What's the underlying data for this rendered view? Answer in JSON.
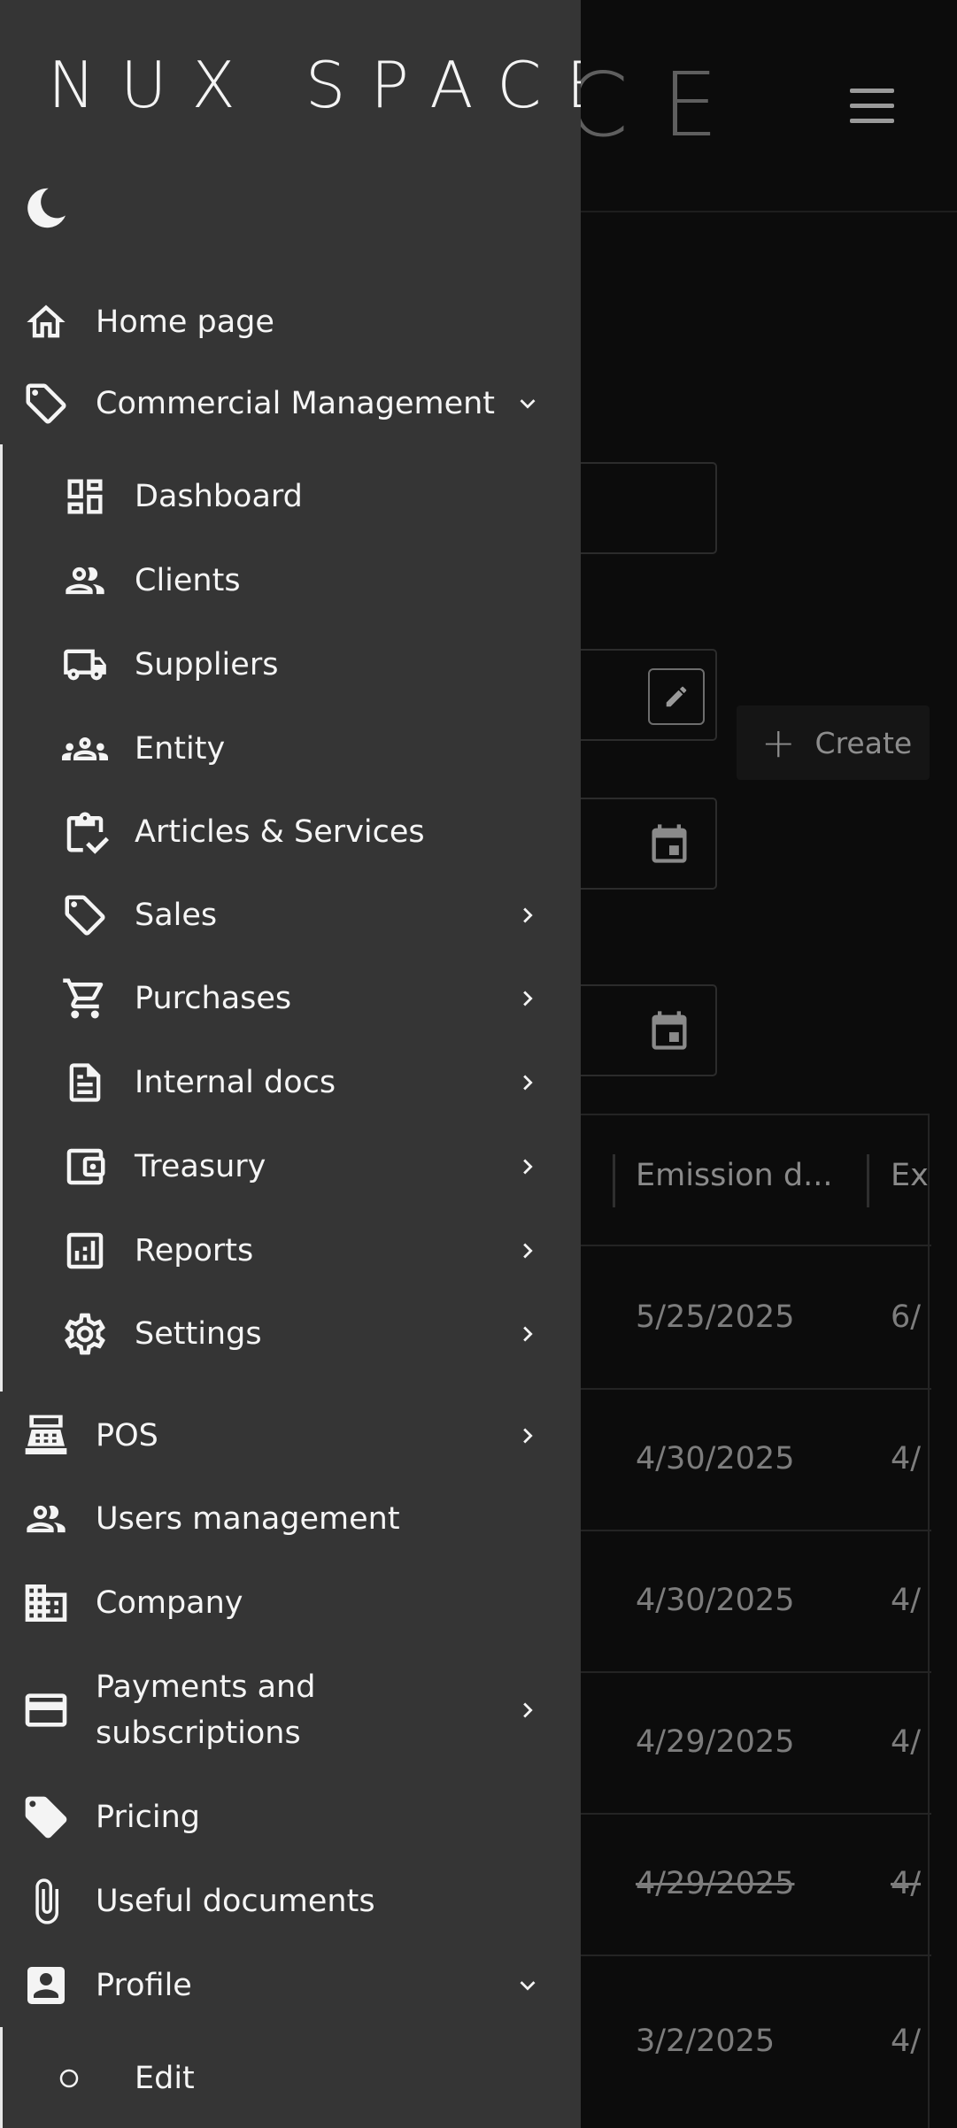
{
  "app": {
    "logo_text": "NUX SPACE",
    "background_logo_text": "CE"
  },
  "background": {
    "create_button": {
      "label": "Create",
      "icon": "plus-icon"
    },
    "table": {
      "columns": [
        "Emission d...",
        "Ex"
      ],
      "rows": [
        {
          "emission_date": "5/25/2025",
          "ex": "6/",
          "cancelled": false
        },
        {
          "emission_date": "4/30/2025",
          "ex": "4/",
          "cancelled": false
        },
        {
          "emission_date": "4/30/2025",
          "ex": "4/",
          "cancelled": false
        },
        {
          "emission_date": "4/29/2025",
          "ex": "4/",
          "cancelled": false
        },
        {
          "emission_date": "4/29/2025",
          "ex": "4/",
          "cancelled": true
        },
        {
          "emission_date": "3/2/2025",
          "ex": "4/",
          "cancelled": false
        }
      ]
    },
    "icons": [
      "hamburger-menu-icon",
      "edit-pencil-icon",
      "calendar-icon"
    ]
  },
  "drawer": {
    "theme_toggle_icon": "moon-icon",
    "home": {
      "label": "Home page",
      "icon": "home-icon"
    },
    "commercial_management": {
      "label": "Commercial Management",
      "icon": "tag-outline-icon",
      "expanded": true,
      "items": [
        {
          "label": "Dashboard",
          "icon": "dashboard-icon",
          "has_submenu": false
        },
        {
          "label": "Clients",
          "icon": "people-icon",
          "has_submenu": false
        },
        {
          "label": "Suppliers",
          "icon": "truck-icon",
          "has_submenu": false
        },
        {
          "label": "Entity",
          "icon": "groups-icon",
          "has_submenu": false
        },
        {
          "label": "Articles & Services",
          "icon": "clipboard-check-icon",
          "has_submenu": false
        },
        {
          "label": "Sales",
          "icon": "tag-outline-icon",
          "has_submenu": true
        },
        {
          "label": "Purchases",
          "icon": "cart-icon",
          "has_submenu": true
        },
        {
          "label": "Internal docs",
          "icon": "document-icon",
          "has_submenu": true
        },
        {
          "label": "Treasury",
          "icon": "wallet-icon",
          "has_submenu": true
        },
        {
          "label": "Reports",
          "icon": "report-chart-icon",
          "has_submenu": true
        },
        {
          "label": "Settings",
          "icon": "gear-icon",
          "has_submenu": true
        }
      ]
    },
    "lower_items": [
      {
        "label": "POS",
        "icon": "cash-register-icon",
        "has_submenu": true
      },
      {
        "label": "Users management",
        "icon": "people-icon",
        "has_submenu": false
      },
      {
        "label": "Company",
        "icon": "building-icon",
        "has_submenu": false
      },
      {
        "label": "Payments and subscriptions",
        "label_line1": "Payments and",
        "label_line2": "subscriptions",
        "icon": "credit-card-icon",
        "has_submenu": true
      },
      {
        "label": "Pricing",
        "icon": "tag-filled-icon",
        "has_submenu": false
      },
      {
        "label": "Useful documents",
        "icon": "paperclip-icon",
        "has_submenu": false
      }
    ],
    "profile": {
      "label": "Profile",
      "icon": "account-box-icon",
      "expanded": true,
      "items": [
        {
          "label": "Edit",
          "icon": "circle-outline-icon"
        }
      ]
    }
  },
  "colors": {
    "drawer_bg": "#353535",
    "page_bg": "#0c0c0c",
    "text": "#f5f5f5",
    "muted_text": "#7d7d7d"
  }
}
